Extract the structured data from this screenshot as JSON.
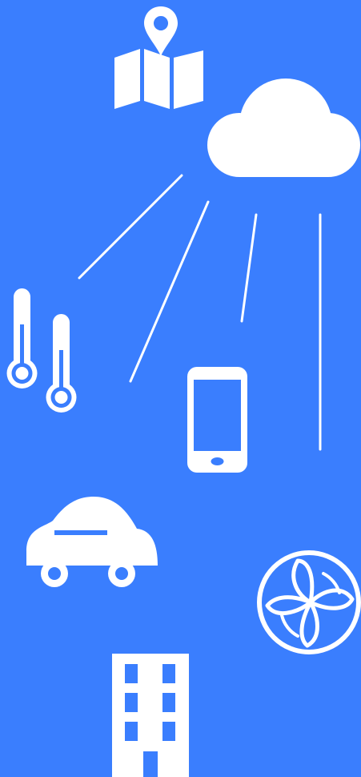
{
  "colors": {
    "background": "#3a7efe",
    "icon": "#ffffff"
  },
  "diagram": {
    "hub": {
      "icon": "cloud-icon"
    },
    "nodes": [
      {
        "id": "map",
        "icon": "map-pin-icon",
        "connected": false
      },
      {
        "id": "thermometers",
        "icon": "thermometer-icon",
        "connected": true
      },
      {
        "id": "smartphone",
        "icon": "smartphone-icon",
        "connected": true
      },
      {
        "id": "car",
        "icon": "car-icon",
        "connected": false
      },
      {
        "id": "fan",
        "icon": "fan-icon",
        "connected": false
      },
      {
        "id": "building",
        "icon": "building-icon",
        "connected": false
      }
    ],
    "connector_count": 4
  }
}
